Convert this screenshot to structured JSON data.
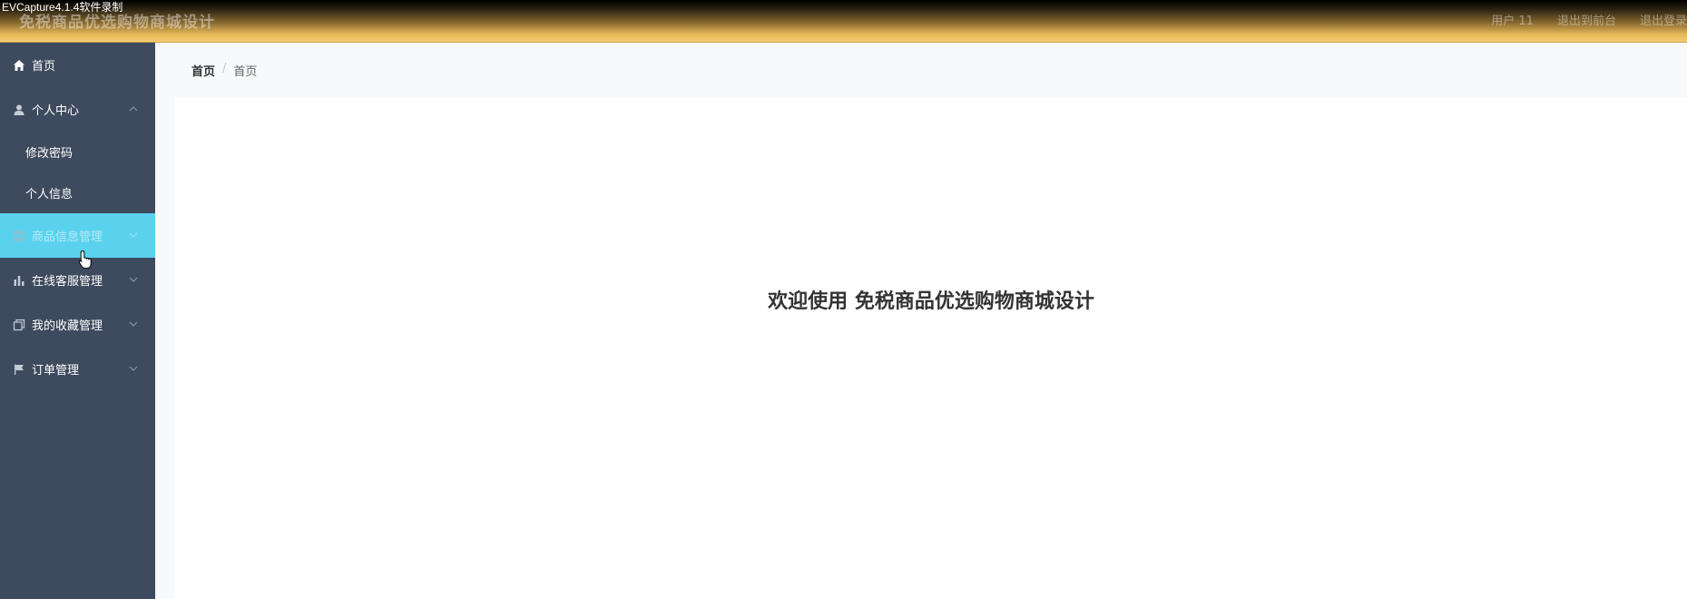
{
  "capture_tag": "EVCapture4.1.4软件录制",
  "header": {
    "title": "免税商品优选购物商城设计",
    "user_label": "用户 11",
    "back_to_front": "退出到前台",
    "logout": "退出登录"
  },
  "sidebar": {
    "items": [
      {
        "label": "首页",
        "icon": "home-icon"
      },
      {
        "label": "个人中心",
        "icon": "user-icon",
        "children": [
          "修改密码",
          "个人信息"
        ]
      },
      {
        "label": "商品信息管理",
        "icon": "grid-icon"
      },
      {
        "label": "在线客服管理",
        "icon": "bar-chart-icon"
      },
      {
        "label": "我的收藏管理",
        "icon": "copy-icon"
      },
      {
        "label": "订单管理",
        "icon": "flag-icon"
      }
    ],
    "active_index": 2
  },
  "breadcrumb": [
    "首页",
    "首页"
  ],
  "breadcrumb_sep": "/",
  "main": {
    "welcome": "欢迎使用 免税商品优选购物商城设计"
  },
  "colors": {
    "sidebar_bg": "#3e4a5e",
    "active_item": "#5ad2ee",
    "header_gradient_end": "#f4cd72"
  }
}
